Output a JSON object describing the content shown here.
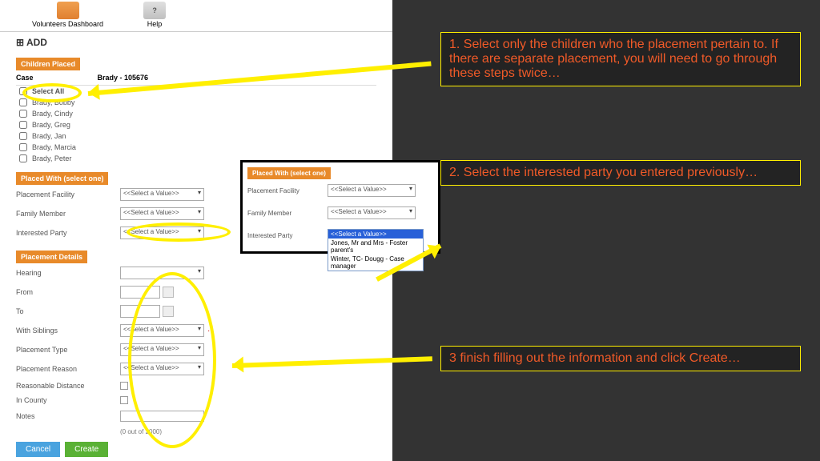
{
  "toolbar": {
    "dashboard": "Volunteers Dashboard",
    "help": "Help",
    "help_glyph": "?"
  },
  "page_title": "ADD",
  "sections": {
    "children_placed": "Children Placed",
    "placed_with": "Placed With (select one)",
    "placement_details": "Placement Details"
  },
  "case_label": "Case",
  "case_value": "Brady - 105676",
  "select_all": "Select All",
  "children": [
    "Brady, Bobby",
    "Brady, Cindy",
    "Brady, Greg",
    "Brady, Jan",
    "Brady, Marcia",
    "Brady, Peter"
  ],
  "placed_with_fields": {
    "facility": "Placement Facility",
    "family": "Family Member",
    "party": "Interested Party"
  },
  "select_placeholder": "<<Select a Value>>",
  "placement_details_fields": {
    "hearing": "Hearing",
    "from": "From",
    "to": "To",
    "with_siblings": "With Siblings",
    "placement_type": "Placement Type",
    "placement_reason": "Placement Reason",
    "reasonable_distance": "Reasonable Distance",
    "in_county": "In County",
    "notes": "Notes"
  },
  "buttons": {
    "cancel": "Cancel",
    "create": "Create"
  },
  "counter": "(0 out of 2000)",
  "dropdown_options": [
    "<<Select a Value>>",
    "Jones, Mr and Mrs - Foster parent's",
    "Winter, TC- Dougg - Case manager"
  ],
  "callouts": {
    "c1": "1. Select only the children who the placement pertain to. If there are separate placement, you will need to go through these steps twice…",
    "c2": "2. Select the interested party you entered previously…",
    "c3": "3 finish filling out the information and click Create…"
  }
}
